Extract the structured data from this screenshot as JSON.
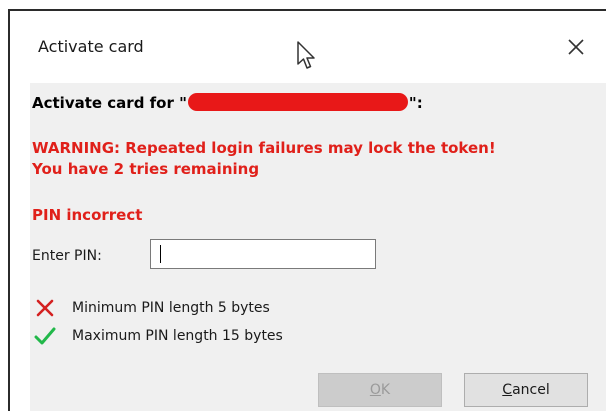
{
  "window": {
    "title": "Activate card",
    "close_glyph": "×"
  },
  "dialog": {
    "heading_prefix": "Activate card for \"",
    "heading_suffix": "\":",
    "warning_line1": "WARNING: Repeated login failures may lock the token!",
    "warning_line2": "You have 2 tries remaining",
    "error": "PIN incorrect",
    "pin_label": "Enter PIN:",
    "pin_value": "",
    "rules": [
      {
        "icon": "red-x-icon",
        "status": "failed",
        "text": "Minimum PIN length 5 bytes"
      },
      {
        "icon": "green-check-icon",
        "status": "passed",
        "text": "Maximum PIN length 15 bytes"
      }
    ],
    "buttons": {
      "ok": {
        "label_underlined": "O",
        "label_rest": "K",
        "enabled": false
      },
      "cancel": {
        "label_underlined": "C",
        "label_rest": "ancel",
        "enabled": true
      }
    }
  },
  "colors": {
    "warning_red": "#e0201a",
    "redaction_red": "#e81818",
    "check_green": "#22b84a",
    "dialog_bg": "#f0f0f0"
  }
}
